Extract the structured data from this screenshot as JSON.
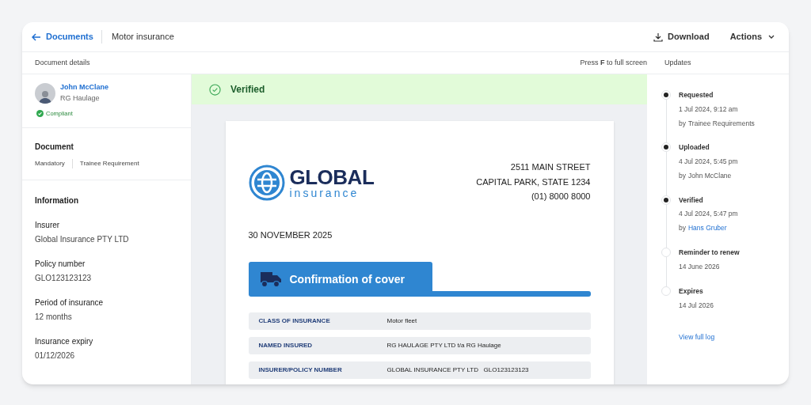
{
  "header": {
    "back_link": "Documents",
    "title": "Motor insurance",
    "download": "Download",
    "actions": "Actions"
  },
  "subheader": {
    "left": "Document details",
    "hint": "Press **F** to full screen",
    "right": "Updates"
  },
  "person": {
    "name": "John McClane",
    "company": "RG Haulage",
    "status": "Compliant"
  },
  "document": {
    "heading": "Document",
    "tags": [
      "Mandatory",
      "Trainee Requirement"
    ]
  },
  "information": {
    "heading": "Information",
    "fields": [
      {
        "label": "Insurer",
        "value": "Global Insurance PTY LTD"
      },
      {
        "label": "Policy number",
        "value": "GLO123123123"
      },
      {
        "label": "Period of insurance",
        "value": "12 months"
      },
      {
        "label": "Insurance expiry",
        "value": "01/12/2026"
      }
    ]
  },
  "banner": {
    "text": "Verified"
  },
  "letter": {
    "logo_main": "GLOBAL",
    "logo_sub": "insurance",
    "address": [
      "2511 MAIN STREET",
      "CAPITAL PARK, STATE 1234",
      "(01) 8000 8000"
    ],
    "date": "30 NOVEMBER 2025",
    "section_title": "Confirmation of cover",
    "rows": [
      {
        "label": "CLASS OF INSURANCE",
        "value": "Motor fleet"
      },
      {
        "label": "NAMED INSURED",
        "value": "RG HAULAGE PTY LTD t/a RG Haulage"
      },
      {
        "label": "INSURER/POLICY NUMBER",
        "value": "GLOBAL INSURANCE PTY LTD   GLO123123123"
      }
    ]
  },
  "timeline": {
    "events": [
      {
        "title": "Requested",
        "date": "1 Jul 2024, 9:12 am",
        "by_prefix": "by",
        "by_name": "Trainee Requirements",
        "by_link": false,
        "done": true
      },
      {
        "title": "Uploaded",
        "date": "4 Jul 2024, 5:45 pm",
        "by_prefix": "by",
        "by_name": "John McClane",
        "by_link": false,
        "done": true
      },
      {
        "title": "Verified",
        "date": "4 Jul 2024, 5:47 pm",
        "by_prefix": "by",
        "by_name": "Hans Gruber",
        "by_link": true,
        "done": true
      },
      {
        "title": "Reminder to renew",
        "date": "14 June 2026",
        "done": false
      },
      {
        "title": "Expires",
        "date": "14 Jul 2026",
        "done": false
      }
    ],
    "link": "View full log"
  }
}
